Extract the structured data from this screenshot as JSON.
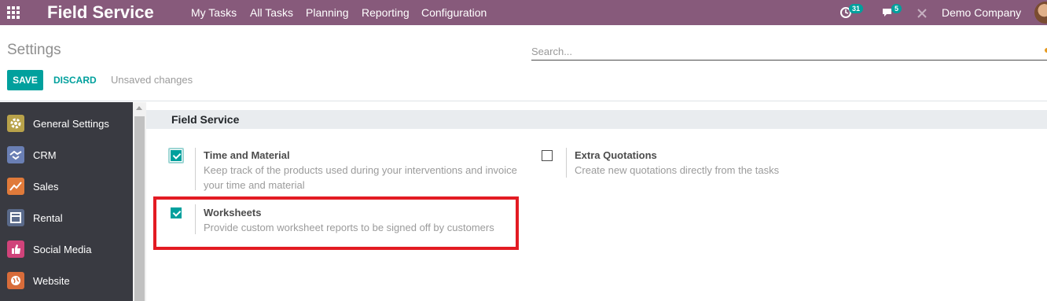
{
  "navbar": {
    "brand": "Field Service",
    "menu": [
      "My Tasks",
      "All Tasks",
      "Planning",
      "Reporting",
      "Configuration"
    ],
    "activity_count": "31",
    "messages_count": "5",
    "company": "Demo Company"
  },
  "control_panel": {
    "title": "Settings",
    "search_placeholder": "Search...",
    "save_label": "SAVE",
    "discard_label": "DISCARD",
    "status": "Unsaved changes"
  },
  "sidebar": {
    "items": [
      {
        "label": "General Settings",
        "icon": "gear-icon",
        "color": "#b8a24a"
      },
      {
        "label": "CRM",
        "icon": "handshake-icon",
        "color": "#6a7fb4"
      },
      {
        "label": "Sales",
        "icon": "chart-icon",
        "color": "#e07a3a"
      },
      {
        "label": "Rental",
        "icon": "rental-icon",
        "color": "#5a6a8a"
      },
      {
        "label": "Social Media",
        "icon": "thumbs-up-icon",
        "color": "#d0437a"
      },
      {
        "label": "Website",
        "icon": "globe-icon",
        "color": "#d86c3a"
      }
    ]
  },
  "content": {
    "section_title": "Field Service",
    "options": [
      {
        "title": "Time and Material",
        "description_line1": "Keep track of the products used during your interventions and invoice",
        "description_line2": "your time and material",
        "checked": true
      },
      {
        "title": "Extra Quotations",
        "description": "Create new quotations directly from the tasks",
        "checked": false
      },
      {
        "title": "Worksheets",
        "description": "Provide custom worksheet reports to be signed off by customers",
        "checked": true
      }
    ]
  },
  "colors": {
    "navbar": "#875a7b",
    "accent": "#00a09d",
    "sidebar": "#393a41",
    "highlight": "#e31b23"
  }
}
